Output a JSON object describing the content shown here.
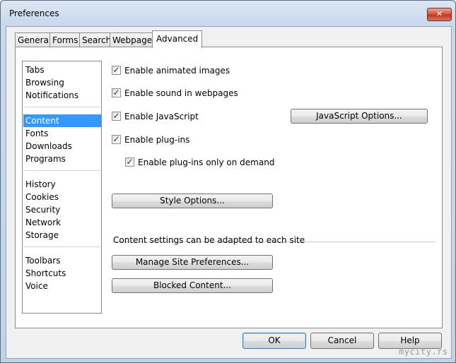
{
  "window": {
    "title": "Preferences",
    "close_glyph": "✕"
  },
  "tabs": [
    {
      "label": "General"
    },
    {
      "label": "Forms"
    },
    {
      "label": "Search"
    },
    {
      "label": "Webpages"
    },
    {
      "label": "Advanced",
      "active": true
    }
  ],
  "nav": {
    "groups": [
      [
        "Tabs",
        "Browsing",
        "Notifications"
      ],
      [
        "Content",
        "Fonts",
        "Downloads",
        "Programs"
      ],
      [
        "History",
        "Cookies",
        "Security",
        "Network",
        "Storage"
      ],
      [
        "Toolbars",
        "Shortcuts",
        "Voice"
      ]
    ],
    "selected": "Content"
  },
  "content": {
    "enable_animated_images": {
      "label": "Enable animated images",
      "checked": true
    },
    "enable_sound": {
      "label": "Enable sound in webpages",
      "checked": true
    },
    "enable_javascript": {
      "label": "Enable JavaScript",
      "checked": true
    },
    "javascript_options_label": "JavaScript Options...",
    "enable_plugins": {
      "label": "Enable plug-ins",
      "checked": true
    },
    "enable_plugins_on_demand": {
      "label": "Enable plug-ins only on demand",
      "checked": true
    },
    "style_options_label": "Style Options...",
    "site_settings_text": "Content settings can be adapted to each site",
    "manage_site_prefs_label": "Manage Site Preferences...",
    "blocked_content_label": "Blocked Content..."
  },
  "footer": {
    "ok_label": "OK",
    "cancel_label": "Cancel",
    "help_label": "Help"
  },
  "watermark": "mycity.rs",
  "colors": {
    "selection": "#3399ff",
    "check": "#1c3f86",
    "close_button": "#c2391f"
  }
}
